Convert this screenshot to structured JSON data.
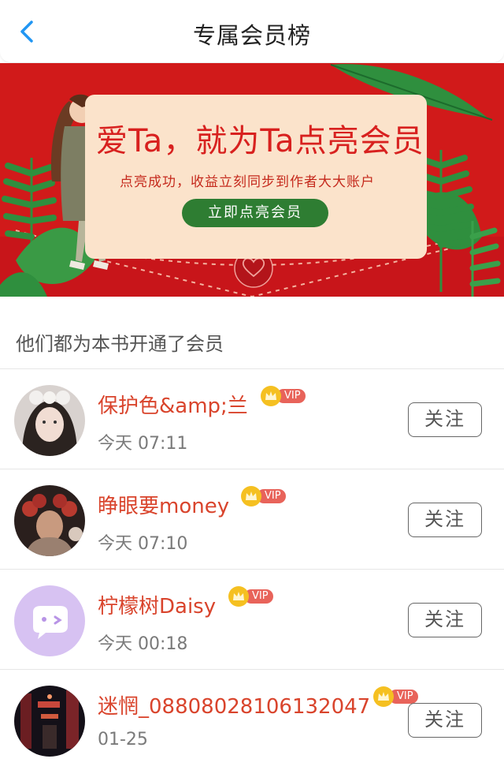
{
  "header": {
    "title": "专属会员榜"
  },
  "banner": {
    "headline": "爱Ta，就为Ta点亮会员",
    "subtitle": "点亮成功，收益立刻同步到作者大大账户",
    "button_label": "立即点亮会员"
  },
  "section": {
    "label": "他们都为本书开通了会员"
  },
  "members": [
    {
      "name": "保护色&amp;兰",
      "time": "今天 07:11",
      "vip": "VIP",
      "follow": "关注"
    },
    {
      "name": "睁眼要money",
      "time": "今天 07:10",
      "vip": "VIP",
      "follow": "关注"
    },
    {
      "name": "柠檬树Daisy",
      "time": "今天 00:18",
      "vip": "VIP",
      "follow": "关注"
    },
    {
      "name": "迷惘_0880802810613204​7",
      "time": "01-25",
      "vip": "VIP",
      "follow": "关注"
    }
  ],
  "colors": {
    "accent": "#d9442c",
    "banner_red": "#d11a1a",
    "vip_gold": "#f5c021",
    "vip_tag": "#e8635a",
    "back_arrow": "#2196f3"
  },
  "icons": {
    "back": "chevron-left-icon",
    "crown": "crown-icon"
  }
}
